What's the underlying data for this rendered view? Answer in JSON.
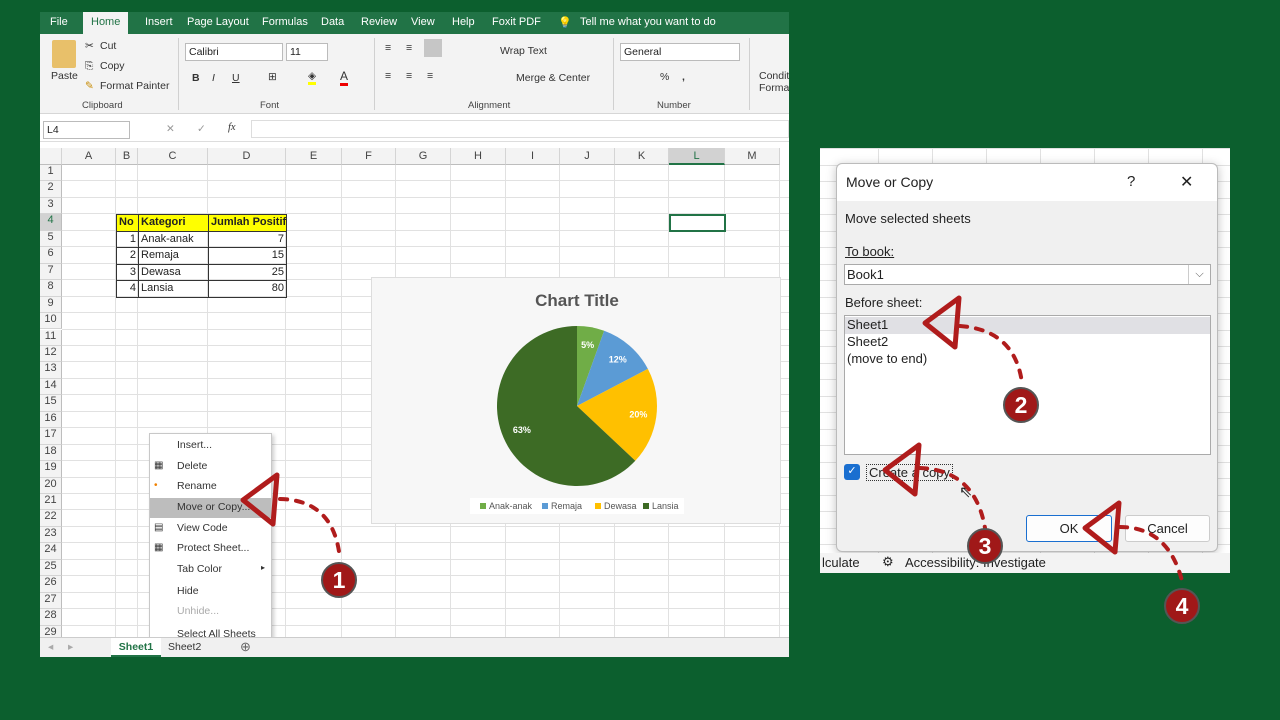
{
  "ribbon": {
    "tabs": [
      "File",
      "Home",
      "Insert",
      "Page Layout",
      "Formulas",
      "Data",
      "Review",
      "View",
      "Help",
      "Foxit PDF"
    ],
    "active_tab": "Home",
    "tell_me": "Tell me what you want to do",
    "clipboard": {
      "paste": "Paste",
      "cut": "Cut",
      "copy": "Copy",
      "format_painter": "Format Painter",
      "group": "Clipboard"
    },
    "font": {
      "name": "Calibri",
      "size": "11",
      "bold": "B",
      "italic": "I",
      "underline": "U",
      "group": "Font"
    },
    "alignment": {
      "wrap": "Wrap Text",
      "merge": "Merge & Center",
      "group": "Alignment"
    },
    "number": {
      "format": "General",
      "percent": "%",
      "comma": ",",
      "group": "Number"
    },
    "styles": {
      "cond1": "Conditi",
      "cond2": "Formatt"
    }
  },
  "formula_bar": {
    "name_box": "L4",
    "fx": "fx",
    "cancel": "✕",
    "enter": "✓",
    "value": ""
  },
  "columns": [
    "A",
    "B",
    "C",
    "D",
    "E",
    "F",
    "G",
    "H",
    "I",
    "J",
    "K",
    "L",
    "M"
  ],
  "rows": [
    "1",
    "2",
    "3",
    "4",
    "5",
    "6",
    "7",
    "8",
    "9",
    "10",
    "11",
    "12",
    "13",
    "14",
    "15",
    "16",
    "17",
    "18",
    "19",
    "20",
    "21",
    "22",
    "23",
    "24",
    "25",
    "26",
    "27",
    "28",
    "29"
  ],
  "table": {
    "headers": [
      "No",
      "Kategori",
      "Jumlah Positif"
    ],
    "rows": [
      [
        "1",
        "Anak-anak",
        "7"
      ],
      [
        "2",
        "Remaja",
        "15"
      ],
      [
        "3",
        "Dewasa",
        "25"
      ],
      [
        "4",
        "Lansia",
        "80"
      ]
    ]
  },
  "selected_cell": "L4",
  "chart_data": {
    "type": "pie",
    "title": "Chart Title",
    "categories": [
      "Anak-anak",
      "Remaja",
      "Dewasa",
      "Lansia"
    ],
    "values": [
      7,
      15,
      25,
      80
    ],
    "labels": [
      "5%",
      "12%",
      "20%",
      "63%"
    ],
    "colors": [
      "#70ad47",
      "#5b9bd5",
      "#ffc000",
      "#3d6b25"
    ],
    "legend": "bottom"
  },
  "context_menu": {
    "items": [
      {
        "label": "Insert...",
        "icon": "",
        "state": "normal"
      },
      {
        "label": "Delete",
        "icon": "delete-sheet-icon",
        "state": "normal"
      },
      {
        "label": "Rename",
        "icon": "rename-icon",
        "state": "normal"
      },
      {
        "label": "Move or Copy...",
        "icon": "",
        "state": "highlighted"
      },
      {
        "label": "View Code",
        "icon": "view-code-icon",
        "state": "normal"
      },
      {
        "label": "Protect Sheet...",
        "icon": "protect-sheet-icon",
        "state": "normal"
      },
      {
        "label": "Tab Color",
        "icon": "",
        "state": "submenu"
      },
      {
        "label": "Hide",
        "icon": "",
        "state": "normal"
      },
      {
        "label": "Unhide...",
        "icon": "",
        "state": "disabled"
      },
      {
        "label": "Select All Sheets",
        "icon": "",
        "state": "normal"
      }
    ]
  },
  "sheet_tabs": [
    "Sheet1",
    "Sheet2"
  ],
  "active_sheet": "Sheet1",
  "dialog": {
    "title": "Move or Copy",
    "help": "?",
    "close": "✕",
    "subtitle": "Move selected sheets",
    "to_book_label": "To book:",
    "to_book_value": "Book1",
    "before_sheet_label": "Before sheet:",
    "sheets": [
      "Sheet1",
      "Sheet2",
      "(move to end)"
    ],
    "selected_sheet": "Sheet1",
    "create_copy_label": "Create a copy",
    "create_copy_checked": true,
    "ok": "OK",
    "cancel": "Cancel"
  },
  "status_bar": {
    "calc": "lculate",
    "accessibility": "Accessibility: Investigate"
  },
  "annotations": {
    "steps": [
      "1",
      "2",
      "3",
      "4"
    ],
    "color": "#b01c1c"
  },
  "colors": {
    "excel_green": "#217346",
    "background": "#0c5f2e",
    "header_yellow": "#ffff00",
    "checkbox": "#1a6fd0"
  }
}
